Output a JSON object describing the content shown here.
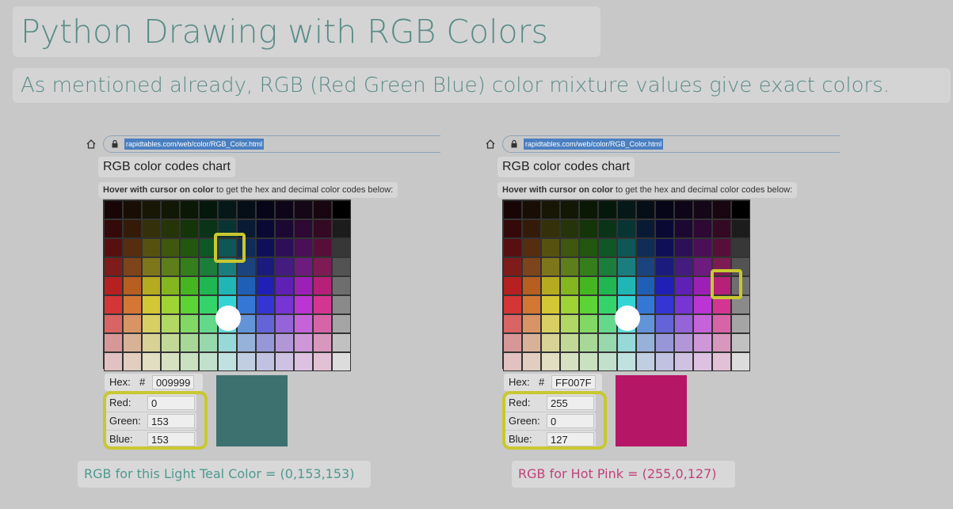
{
  "slide": {
    "title": "Python Drawing with RGB Colors",
    "subtitle": "As mentioned already, RGB (Red Green Blue) color mixture values give exact colors."
  },
  "panels": [
    {
      "url": "rapidtables.com/web/color/RGB_Color.html",
      "heading": "RGB color codes chart",
      "hover_bold": "Hover with cursor on color",
      "hover_rest": " to get the hex and decimal color codes below:",
      "hex_label": "Hex:",
      "hash": "#",
      "hex_value": "009999",
      "red_label": "Red:",
      "red_value": "0",
      "green_label": "Green:",
      "green_value": "153",
      "blue_label": "Blue:",
      "blue_value": "153",
      "preview_color": "#3d7170",
      "caption": "RGB for this Light Teal Color = (0,153,153)",
      "caption_color": "#4e9a8e"
    },
    {
      "url": "rapidtables.com/web/color/RGB_Color.html",
      "heading": "RGB color codes chart",
      "hover_bold": "Hover with cursor on color",
      "hover_rest": " to get the hex and decimal color codes below:",
      "hex_label": "Hex:",
      "hash": "#",
      "hex_value": "FF007F",
      "red_label": "Red:",
      "red_value": "255",
      "green_label": "Green:",
      "green_value": "0",
      "blue_label": "Blue:",
      "blue_value": "127",
      "preview_color": "#b51666",
      "caption": "RGB for Hot Pink = (255,0,127)",
      "caption_color": "#c0427a"
    }
  ],
  "colors": {
    "highlight": "#c8c830",
    "title_text": "#5a8c87"
  },
  "icons": [
    "home-icon",
    "lock-icon"
  ]
}
